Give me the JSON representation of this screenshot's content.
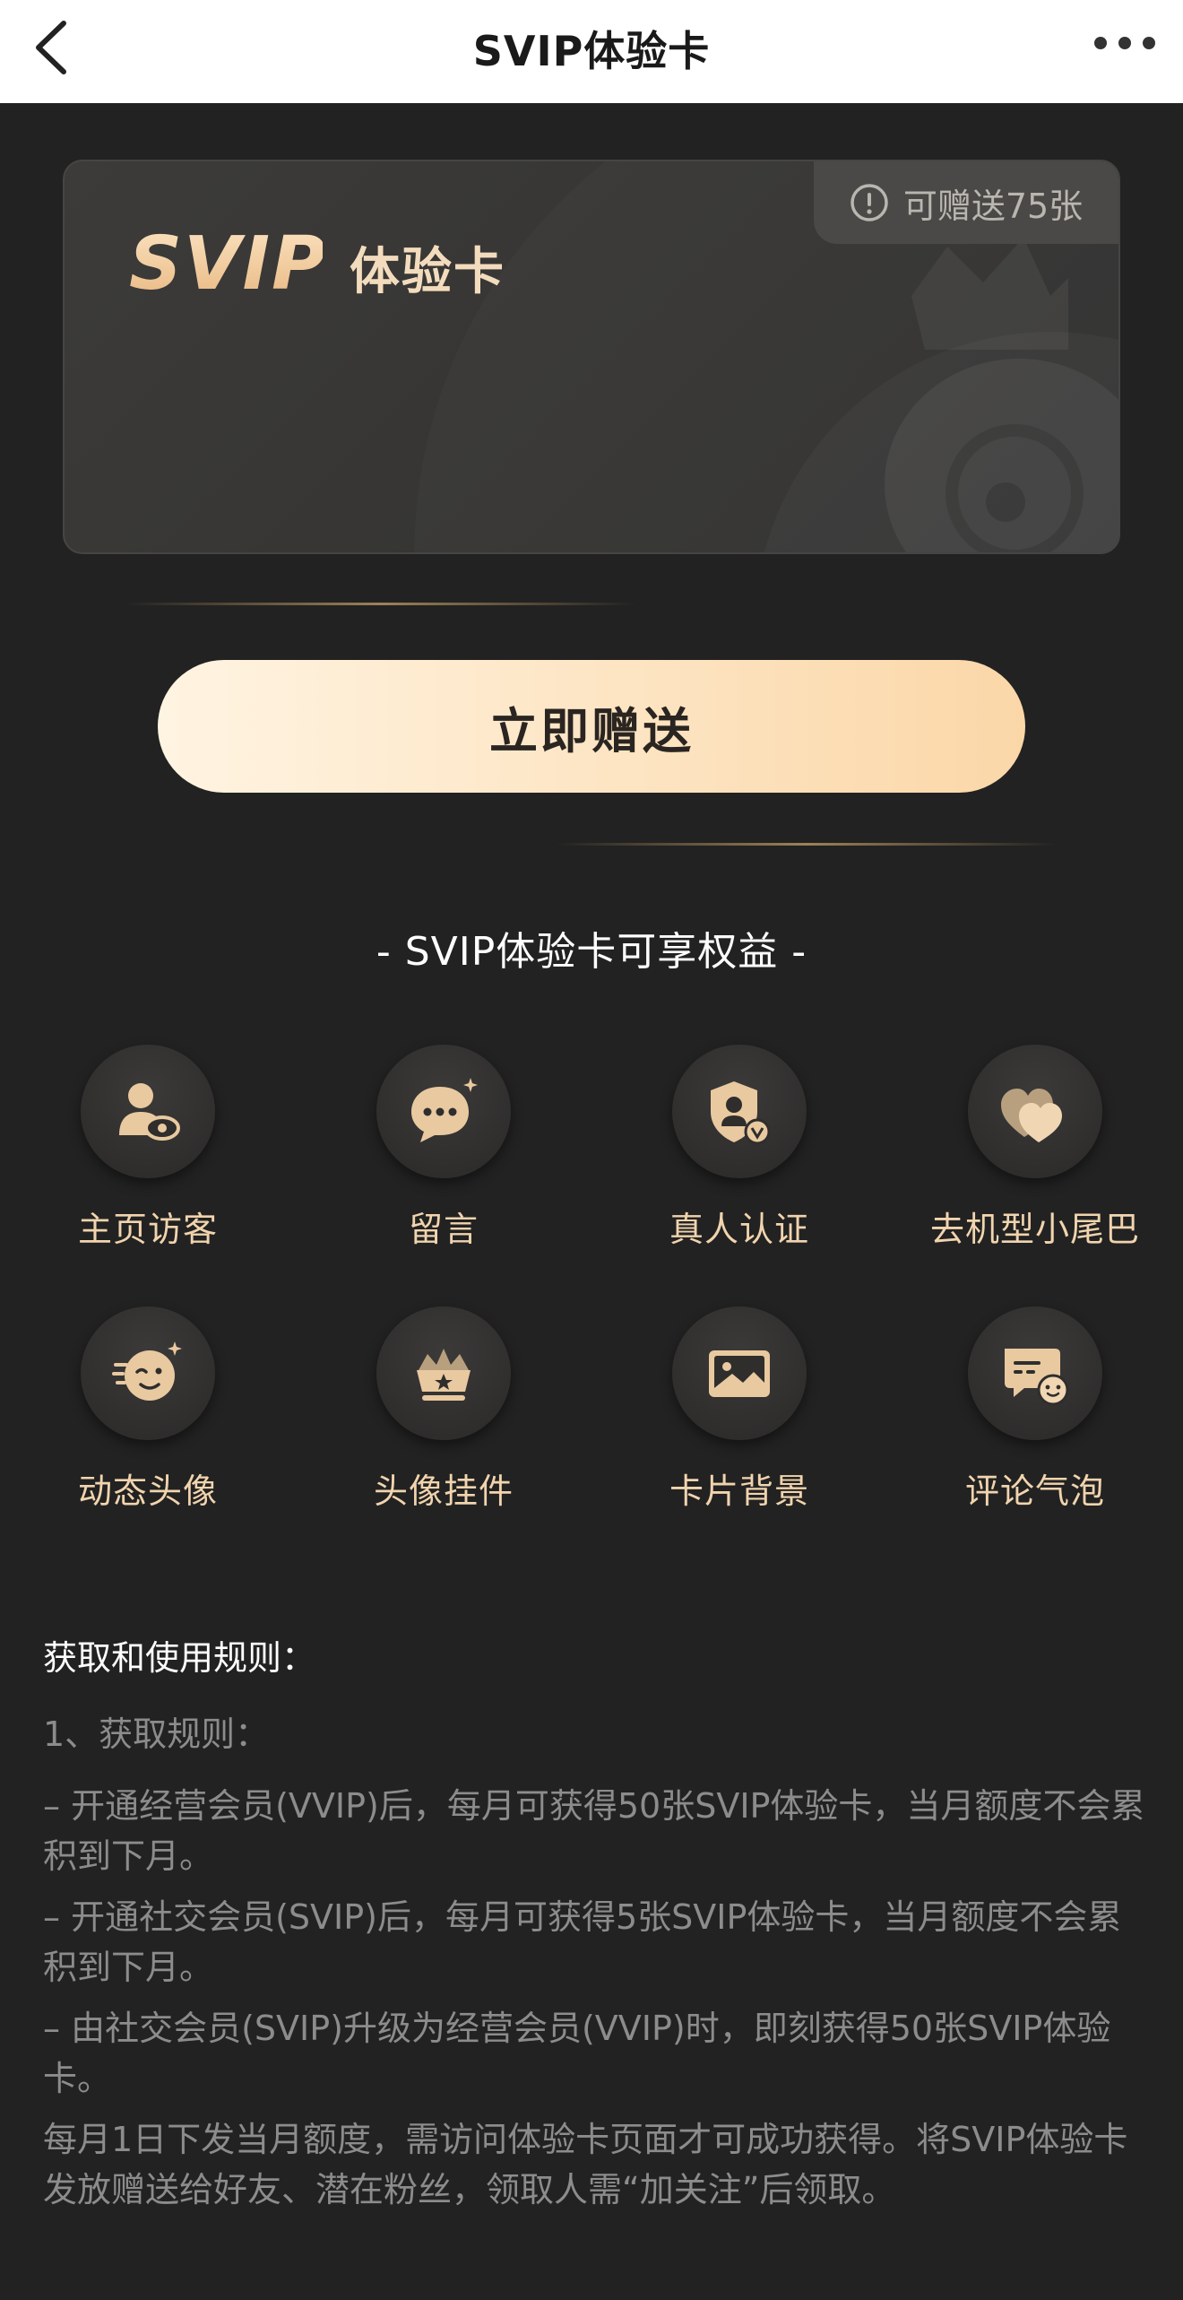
{
  "nav": {
    "title": "SVIP体验卡"
  },
  "card": {
    "logo_text": "SVIP",
    "subtitle": "体验卡",
    "remaining_label": "可赠送75张"
  },
  "action": {
    "gift_button": "立即赠送"
  },
  "benefits": {
    "title": "- SVIP体验卡可享权益 -",
    "items": [
      {
        "label": "主页访客",
        "icon": "visitor-icon"
      },
      {
        "label": "留言",
        "icon": "message-icon"
      },
      {
        "label": "真人认证",
        "icon": "verified-shield-icon"
      },
      {
        "label": "去机型小尾巴",
        "icon": "heart-icon"
      },
      {
        "label": "动态头像",
        "icon": "dynamic-avatar-icon"
      },
      {
        "label": "头像挂件",
        "icon": "avatar-pendant-icon"
      },
      {
        "label": "卡片背景",
        "icon": "card-background-icon"
      },
      {
        "label": "评论气泡",
        "icon": "comment-bubble-icon"
      }
    ]
  },
  "rules": {
    "heading": "获取和使用规则：",
    "sub": "1、获取规则：",
    "paragraphs": [
      "– 开通经营会员(VVIP)后，每月可获得50张SVIP体验卡，当月额度不会累积到下月。",
      "– 开通社交会员(SVIP)后，每月可获得5张SVIP体验卡，当月额度不会累积到下月。",
      "– 由社交会员(SVIP)升级为经营会员(VVIP)时，即刻获得50张SVIP体验卡。",
      "每月1日下发当月额度，需访问体验卡页面才可成功获得。将SVIP体验卡发放赠送给好友、潜在粉丝，领取人需“加关注”后领取。"
    ]
  },
  "colors": {
    "background": "#222222",
    "gold_text": "#f1d4ae",
    "button_start": "#fff4e2",
    "button_end": "#fbd7a8",
    "muted_text": "#8c8c8c"
  }
}
